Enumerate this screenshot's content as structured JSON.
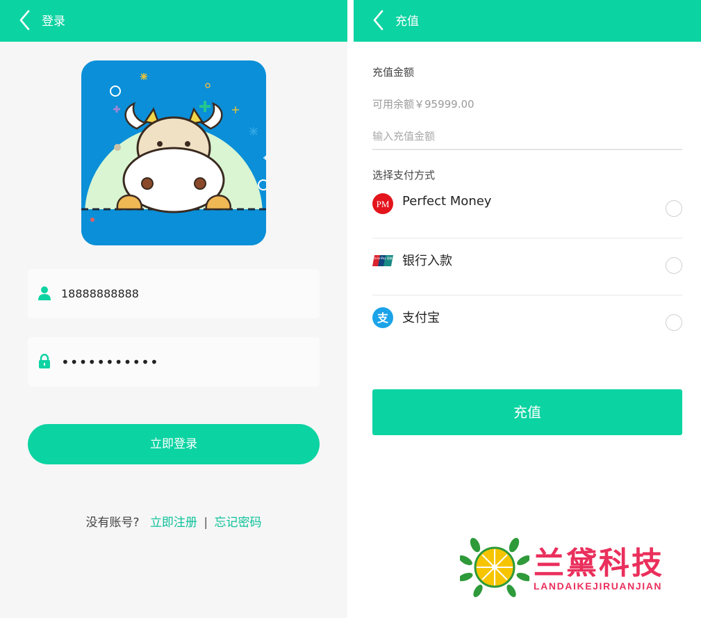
{
  "login": {
    "header": {
      "title": "登录"
    },
    "phone": {
      "value": "18888888888"
    },
    "password": {
      "value": "•••••••••••"
    },
    "login_button": "立即登录",
    "footer": {
      "no_account": "没有账号?",
      "register": "立即注册",
      "separator": "|",
      "forgot": "忘记密码"
    }
  },
  "recharge": {
    "header": {
      "title": "充值"
    },
    "amount_label": "充值金额",
    "balance_text": "可用余额￥95999.00",
    "amount_placeholder": "输入充值金额",
    "method_label": "选择支付方式",
    "methods": [
      {
        "name": "Perfect Money",
        "icon": "perfect-money-icon",
        "icon_text": "PM"
      },
      {
        "name": "银行入款",
        "icon": "unionpay-icon",
        "icon_text": "UnionPay 银联"
      },
      {
        "name": "支付宝",
        "icon": "alipay-icon",
        "icon_text": "支"
      }
    ],
    "submit_button": "充值"
  },
  "watermark": {
    "cn": "兰黛科技",
    "en": "LANDAIKEJIRUANJIAN"
  },
  "colors": {
    "brand": "#0cd3a2",
    "link": "#0cc29a",
    "watermark": "#ea2f5c"
  }
}
